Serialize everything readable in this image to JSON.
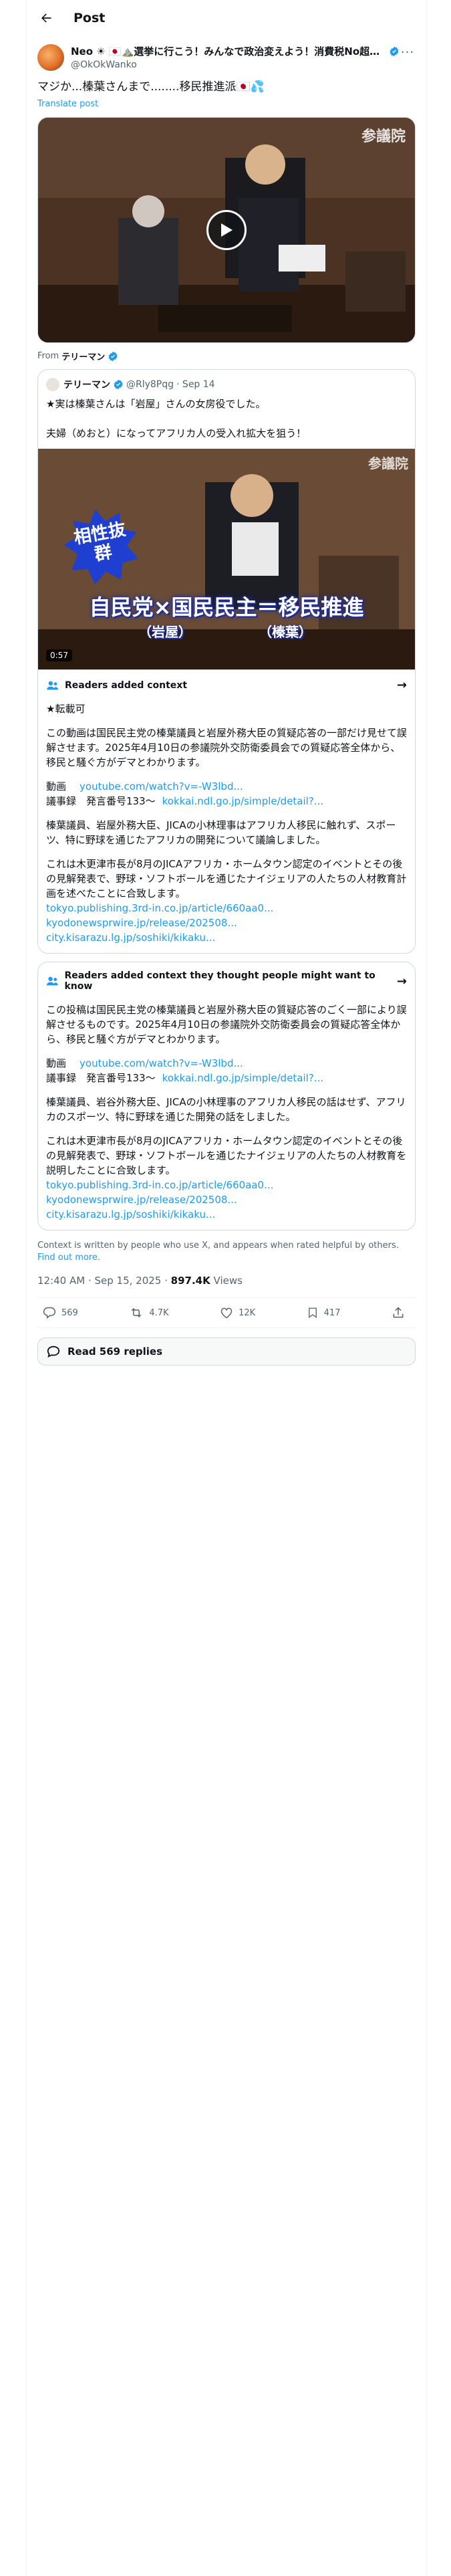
{
  "header": {
    "title": "Post"
  },
  "post": {
    "author_name": "Neo ☀ 🇯🇵⛰️選挙に行こう！みんなで政治変えよう！消費税No超過...",
    "handle": "@OkOkWanko",
    "text": "マジか...榛葉さんまで........移民推進派🇯🇵💦",
    "translate": "Translate post",
    "video_watermark": "参議院",
    "from_label": "From",
    "from_name": "テリーマン"
  },
  "quoted": {
    "name": "テリーマン",
    "handle": "@Rly8Pqg",
    "date": "· Sep 14",
    "text": "★実は榛葉さんは「岩屋」さんの女房役でした。\n\n夫婦（めおと）になってアフリカ人の受入れ拡大を狙う！",
    "badge": "相性抜群",
    "caption_main": "自民党×国民民主＝移民推進",
    "caption_left": "（岩屋）",
    "caption_right": "（榛葉）",
    "watermark": "参議院",
    "duration": "0:57"
  },
  "note1": {
    "heading": "Readers added context",
    "intro": "★転載可",
    "body": "この動画は国民民主党の榛葉議員と岩屋外務大臣の質疑応答の一部だけ見せて誤解させます。2025年4月10日の参議院外交防衛委員会での質疑応答全体から、移民と騒ぐ方がデマとわかります。",
    "video_label": "動画",
    "video_link": "youtube.com/watch?v=-W3lbd...",
    "minutes_label": "議事録　発言番号133〜",
    "minutes_link": "kokkai.ndl.go.jp/simple/detail?...",
    "body2": "榛葉議員、岩屋外務大臣、JICAの小林理事はアフリカ人移民に触れず、スポーツ、特に野球を通じたアフリカの開発について議論しました。",
    "body3": "これは木更津市長が8月のJICAアフリカ・ホームタウン認定のイベントとその後の見解発表で、野球・ソフトボールを通じたナイジェリアの人たちの人材教育計画を述べたことに合致します。",
    "links": [
      "tokyo.publishing.3rd-in.co.jp/article/660aa0...",
      "kyodonewsprwire.jp/release/202508...",
      "city.kisarazu.lg.jp/soshiki/kikaku..."
    ]
  },
  "note2": {
    "heading": "Readers added context they thought people might want to know",
    "body": "この投稿は国民民主党の榛葉議員と岩屋外務大臣の質疑応答のごく一部により誤解させるものです。2025年4月10日の参議院外交防衛委員会の質疑応答全体から、移民と騒ぐ方がデマとわかります。",
    "video_label": "動画",
    "video_link": "youtube.com/watch?v=-W3lbd...",
    "minutes_label": "議事録　発言番号133〜",
    "minutes_link": "kokkai.ndl.go.jp/simple/detail?...",
    "body2": "榛葉議員、岩谷外務大臣、JICAの小林理事のアフリカ人移民の話はせず、アフリカのスポーツ、特に野球を通じた開発の話をしました。",
    "body3": "これは木更津市長が8月のJICAアフリカ・ホームタウン認定のイベントとその後の見解発表で、野球・ソフトボールを通じたナイジェリアの人たちの人材教育を説明したことに合致します。",
    "links": [
      "tokyo.publishing.3rd-in.co.jp/article/660aa0...",
      "kyodonewsprwire.jp/release/202508...",
      "city.kisarazu.lg.jp/soshiki/kikaku..."
    ]
  },
  "footer_note": {
    "text": "Context is written by people who use X, and appears when rated helpful by others.",
    "find_more": "Find out more."
  },
  "meta": {
    "time": "12:40 AM · Sep 15, 2025 ·",
    "views": "897.4K",
    "views_label": "Views"
  },
  "actions": {
    "replies": "569",
    "reposts": "4.7K",
    "likes": "12K",
    "bookmarks": "417"
  },
  "read_replies": "Read 569 replies",
  "colors": {
    "accent": "#1d9bf0",
    "text": "#0f1419",
    "muted": "#536471",
    "border": "#cfd9de"
  }
}
